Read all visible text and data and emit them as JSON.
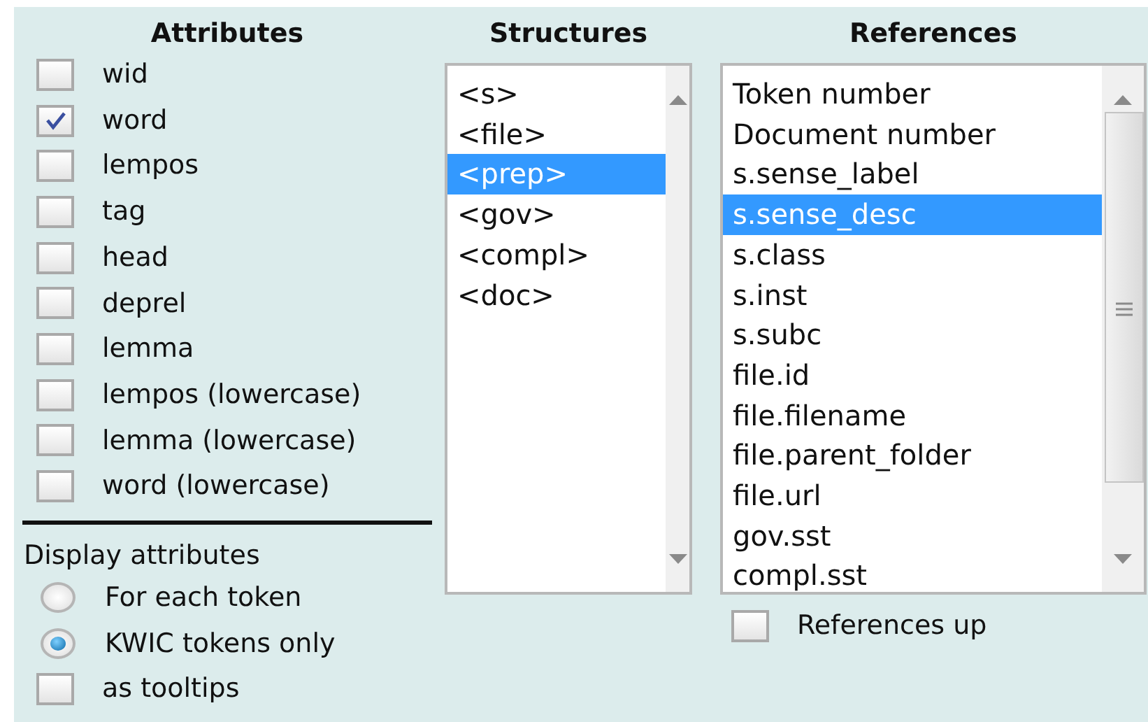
{
  "attributes": {
    "heading": "Attributes",
    "items": [
      {
        "label": "wid",
        "checked": false
      },
      {
        "label": "word",
        "checked": true
      },
      {
        "label": "lempos",
        "checked": false
      },
      {
        "label": "tag",
        "checked": false
      },
      {
        "label": "head",
        "checked": false
      },
      {
        "label": "deprel",
        "checked": false
      },
      {
        "label": "lemma",
        "checked": false
      },
      {
        "label": "lempos (lowercase)",
        "checked": false
      },
      {
        "label": "lemma (lowercase)",
        "checked": false
      },
      {
        "label": "word (lowercase)",
        "checked": false
      }
    ]
  },
  "display": {
    "label": "Display attributes",
    "options": [
      {
        "label": "For each token",
        "selected": false
      },
      {
        "label": "KWIC tokens only",
        "selected": true
      }
    ],
    "tooltips": {
      "label": "as tooltips",
      "checked": false
    }
  },
  "structures": {
    "heading": "Structures",
    "items": [
      {
        "label": "<s>",
        "selected": false
      },
      {
        "label": "<file>",
        "selected": false
      },
      {
        "label": "<prep>",
        "selected": true
      },
      {
        "label": "<gov>",
        "selected": false
      },
      {
        "label": "<compl>",
        "selected": false
      },
      {
        "label": "<doc>",
        "selected": false
      }
    ]
  },
  "references": {
    "heading": "References",
    "items": [
      {
        "label": "Token number",
        "selected": false
      },
      {
        "label": "Document number",
        "selected": false
      },
      {
        "label": "s.sense_label",
        "selected": false
      },
      {
        "label": "s.sense_desc",
        "selected": true
      },
      {
        "label": "s.class",
        "selected": false
      },
      {
        "label": "s.inst",
        "selected": false
      },
      {
        "label": "s.subc",
        "selected": false
      },
      {
        "label": "file.id",
        "selected": false
      },
      {
        "label": "file.filename",
        "selected": false
      },
      {
        "label": "file.parent_folder",
        "selected": false
      },
      {
        "label": "file.url",
        "selected": false
      },
      {
        "label": "gov.sst",
        "selected": false
      },
      {
        "label": "compl.sst",
        "selected": false
      }
    ],
    "references_up": {
      "label": "References up",
      "checked": false
    }
  }
}
